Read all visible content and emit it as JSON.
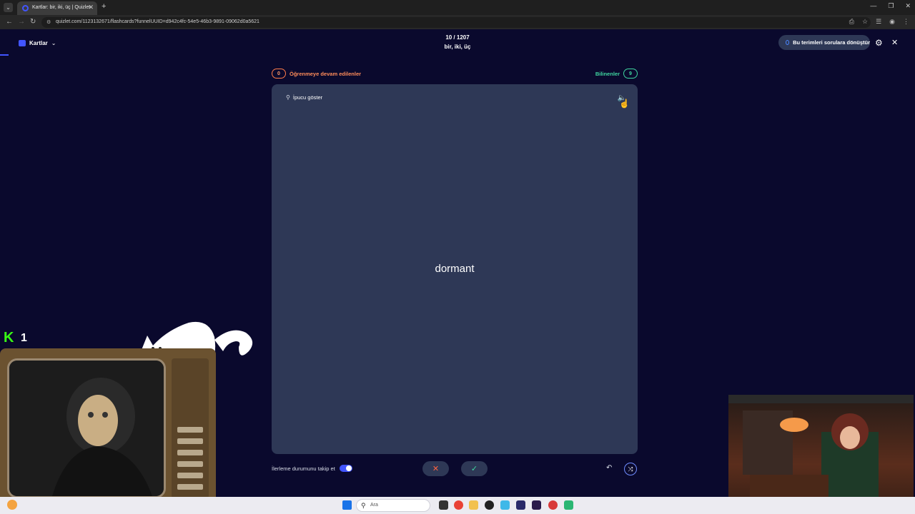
{
  "browser": {
    "tab_title": "Kartlar: bir, iki, üç | Quizlet",
    "url": "quizlet.com/1123132671/flashcards?funnelUUID=d942c4fc-54e5-46b3-9891-09062d0a5621"
  },
  "header": {
    "mode_label": "Kartlar",
    "progress": "10 / 1207",
    "set_title": "bir, iki, üç",
    "convert_label": "Bu terimleri sorulara dönüştür"
  },
  "counters": {
    "learning_count": "0",
    "learning_label": "Öğrenmeye devam edilenler",
    "known_label": "Bilinenler",
    "known_count": "9"
  },
  "card": {
    "hint_label": "İpucu göster",
    "term": "dormant"
  },
  "controls": {
    "track_label": "İlerleme durumunu takip et",
    "track_enabled": true
  },
  "overlay": {
    "k_count": "1"
  },
  "taskbar": {
    "search_placeholder": "Ara"
  },
  "colors": {
    "background": "#0a092d",
    "card": "#2e3856",
    "accent": "#4255ff",
    "learning": "#ff8c5a",
    "known": "#3fd6a0"
  }
}
